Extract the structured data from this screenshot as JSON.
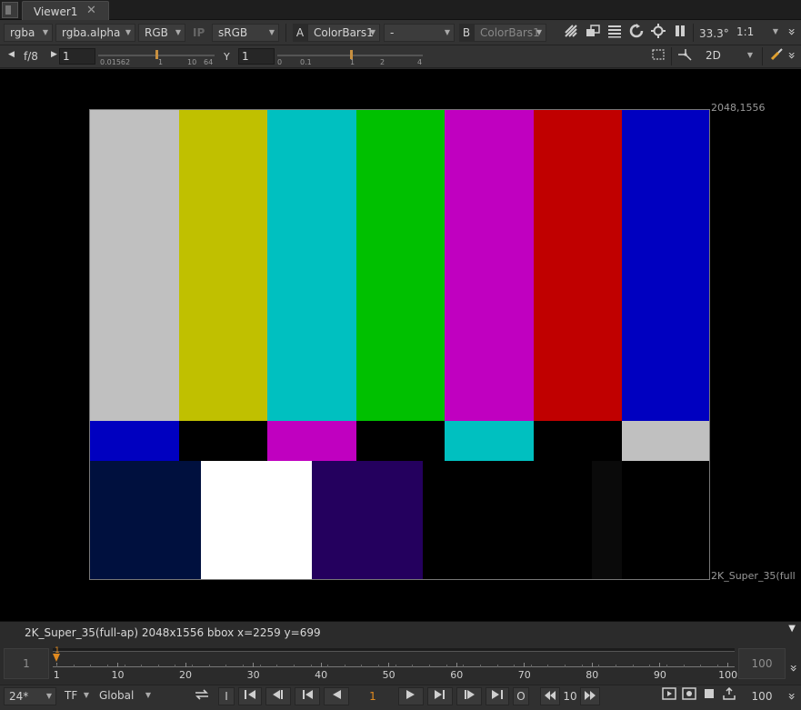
{
  "tab": {
    "title": "Viewer1",
    "close": "✕"
  },
  "toolbar": {
    "channels": "rgba",
    "alpha": "rgba.alpha",
    "display_channel": "RGB",
    "ip": "IP",
    "colorspace": "sRGB",
    "input_a_label": "A",
    "input_a": "ColorBars1",
    "operation": "-",
    "input_b_label": "B",
    "input_b": "ColorBars1",
    "zoom": "33.3°",
    "ratio": "1:1",
    "chevron": "»"
  },
  "toolbar2": {
    "fstop": "f/8",
    "gain_value": "1",
    "gain_ticks": [
      "0.01562",
      "1",
      "10",
      "64"
    ],
    "gamma_label": "Y",
    "gamma_value": "1",
    "gamma_ticks": [
      "0",
      "0.1",
      "1",
      "2",
      "4"
    ],
    "view_mode": "2D"
  },
  "viewer": {
    "top_right_label": "2048,1556",
    "format_label": "2K_Super_35(full",
    "colorbar_colors": {
      "main": [
        "#c0c0c0",
        "#c0c000",
        "#00c0c0",
        "#00c000",
        "#c000c0",
        "#c00000",
        "#0000c0"
      ],
      "mid": [
        "#0000c0",
        "#000000",
        "#c000c0",
        "#000000",
        "#00c0c0",
        "#000000",
        "#c0c0c0"
      ],
      "bottom": [
        "#00103e",
        "#ffffff",
        "#24005e",
        "#000000",
        "#000000",
        "#0a0a0a",
        "#000000"
      ]
    }
  },
  "info": {
    "text": "2K_Super_35(full-ap) 2048x1556  bbox  x=2259 y=699"
  },
  "timeline": {
    "start": "1",
    "end": "100",
    "current": "1",
    "ticks": [
      "1",
      "10",
      "20",
      "30",
      "40",
      "50",
      "60",
      "70",
      "80",
      "90",
      "100"
    ]
  },
  "controls": {
    "fps": "24*",
    "tf": "TF",
    "global": "Global",
    "in_label": "I",
    "frame": "1",
    "out_label": "O",
    "step": "10",
    "end_frame": "100"
  }
}
